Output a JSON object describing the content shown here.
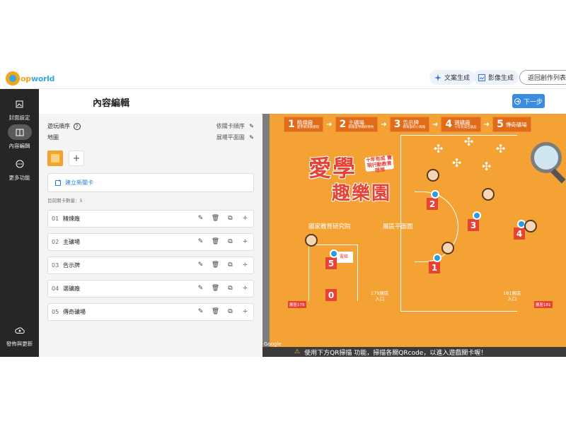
{
  "app": {
    "logo_text_a": "P",
    "logo_text_b": "op",
    "logo_text_c": "world"
  },
  "topbar": {
    "doc_gen_label": "文案生成",
    "image_gen_label": "影像生成",
    "back_label": "返回創作列表"
  },
  "rail": {
    "items": [
      {
        "label": "封面設定",
        "icon": "cover-icon"
      },
      {
        "label": "內容編輯",
        "icon": "book-icon"
      },
      {
        "label": "更多功能",
        "icon": "more-icon"
      }
    ],
    "publish_label": "發佈與更新"
  },
  "panel": {
    "title": "內容編輯",
    "play_order_label": "遊玩順序",
    "play_order_value": "依關卡順序",
    "map_label": "地圖",
    "map_value": "展場平面圖",
    "new_card_label": "建立新關卡",
    "count_label": "目前關卡數量：5",
    "cards": [
      {
        "num": "01",
        "name": "精煉廠"
      },
      {
        "num": "02",
        "name": "主礦場"
      },
      {
        "num": "03",
        "name": "告示牌"
      },
      {
        "num": "04",
        "name": "選礦廠"
      },
      {
        "num": "05",
        "name": "傳奇礦場"
      }
    ]
  },
  "preview": {
    "next_label": "下一步",
    "banner": [
      {
        "n": "1",
        "t": "精煉廠",
        "s": "愛學網演奏歷程"
      },
      {
        "n": "2",
        "t": "主礦場",
        "s": "新版愛學網的特色"
      },
      {
        "n": "3",
        "t": "告示牌",
        "s": "教育部的小海報"
      },
      {
        "n": "4",
        "t": "選礦廠",
        "s": "十年有成出版品"
      },
      {
        "n": "5",
        "t": "傳奇礦場",
        "s": ""
      }
    ],
    "title_a": "愛學",
    "title_b": "趣樂園",
    "subtitle": "十年有成 實現行動教育理想",
    "institute": "國家教育研究院",
    "hall": "展區平面圖",
    "elevator": "電梯",
    "entrance_179": "179展區\n入口",
    "entrance_181": "181展區\n入口",
    "room_179": "展區179",
    "room_181": "展區181",
    "bottom_msg": "使用下方QR掃描    功能，掃描各關QRcode，以進入遊戲關卡喔！",
    "google": "Google"
  }
}
